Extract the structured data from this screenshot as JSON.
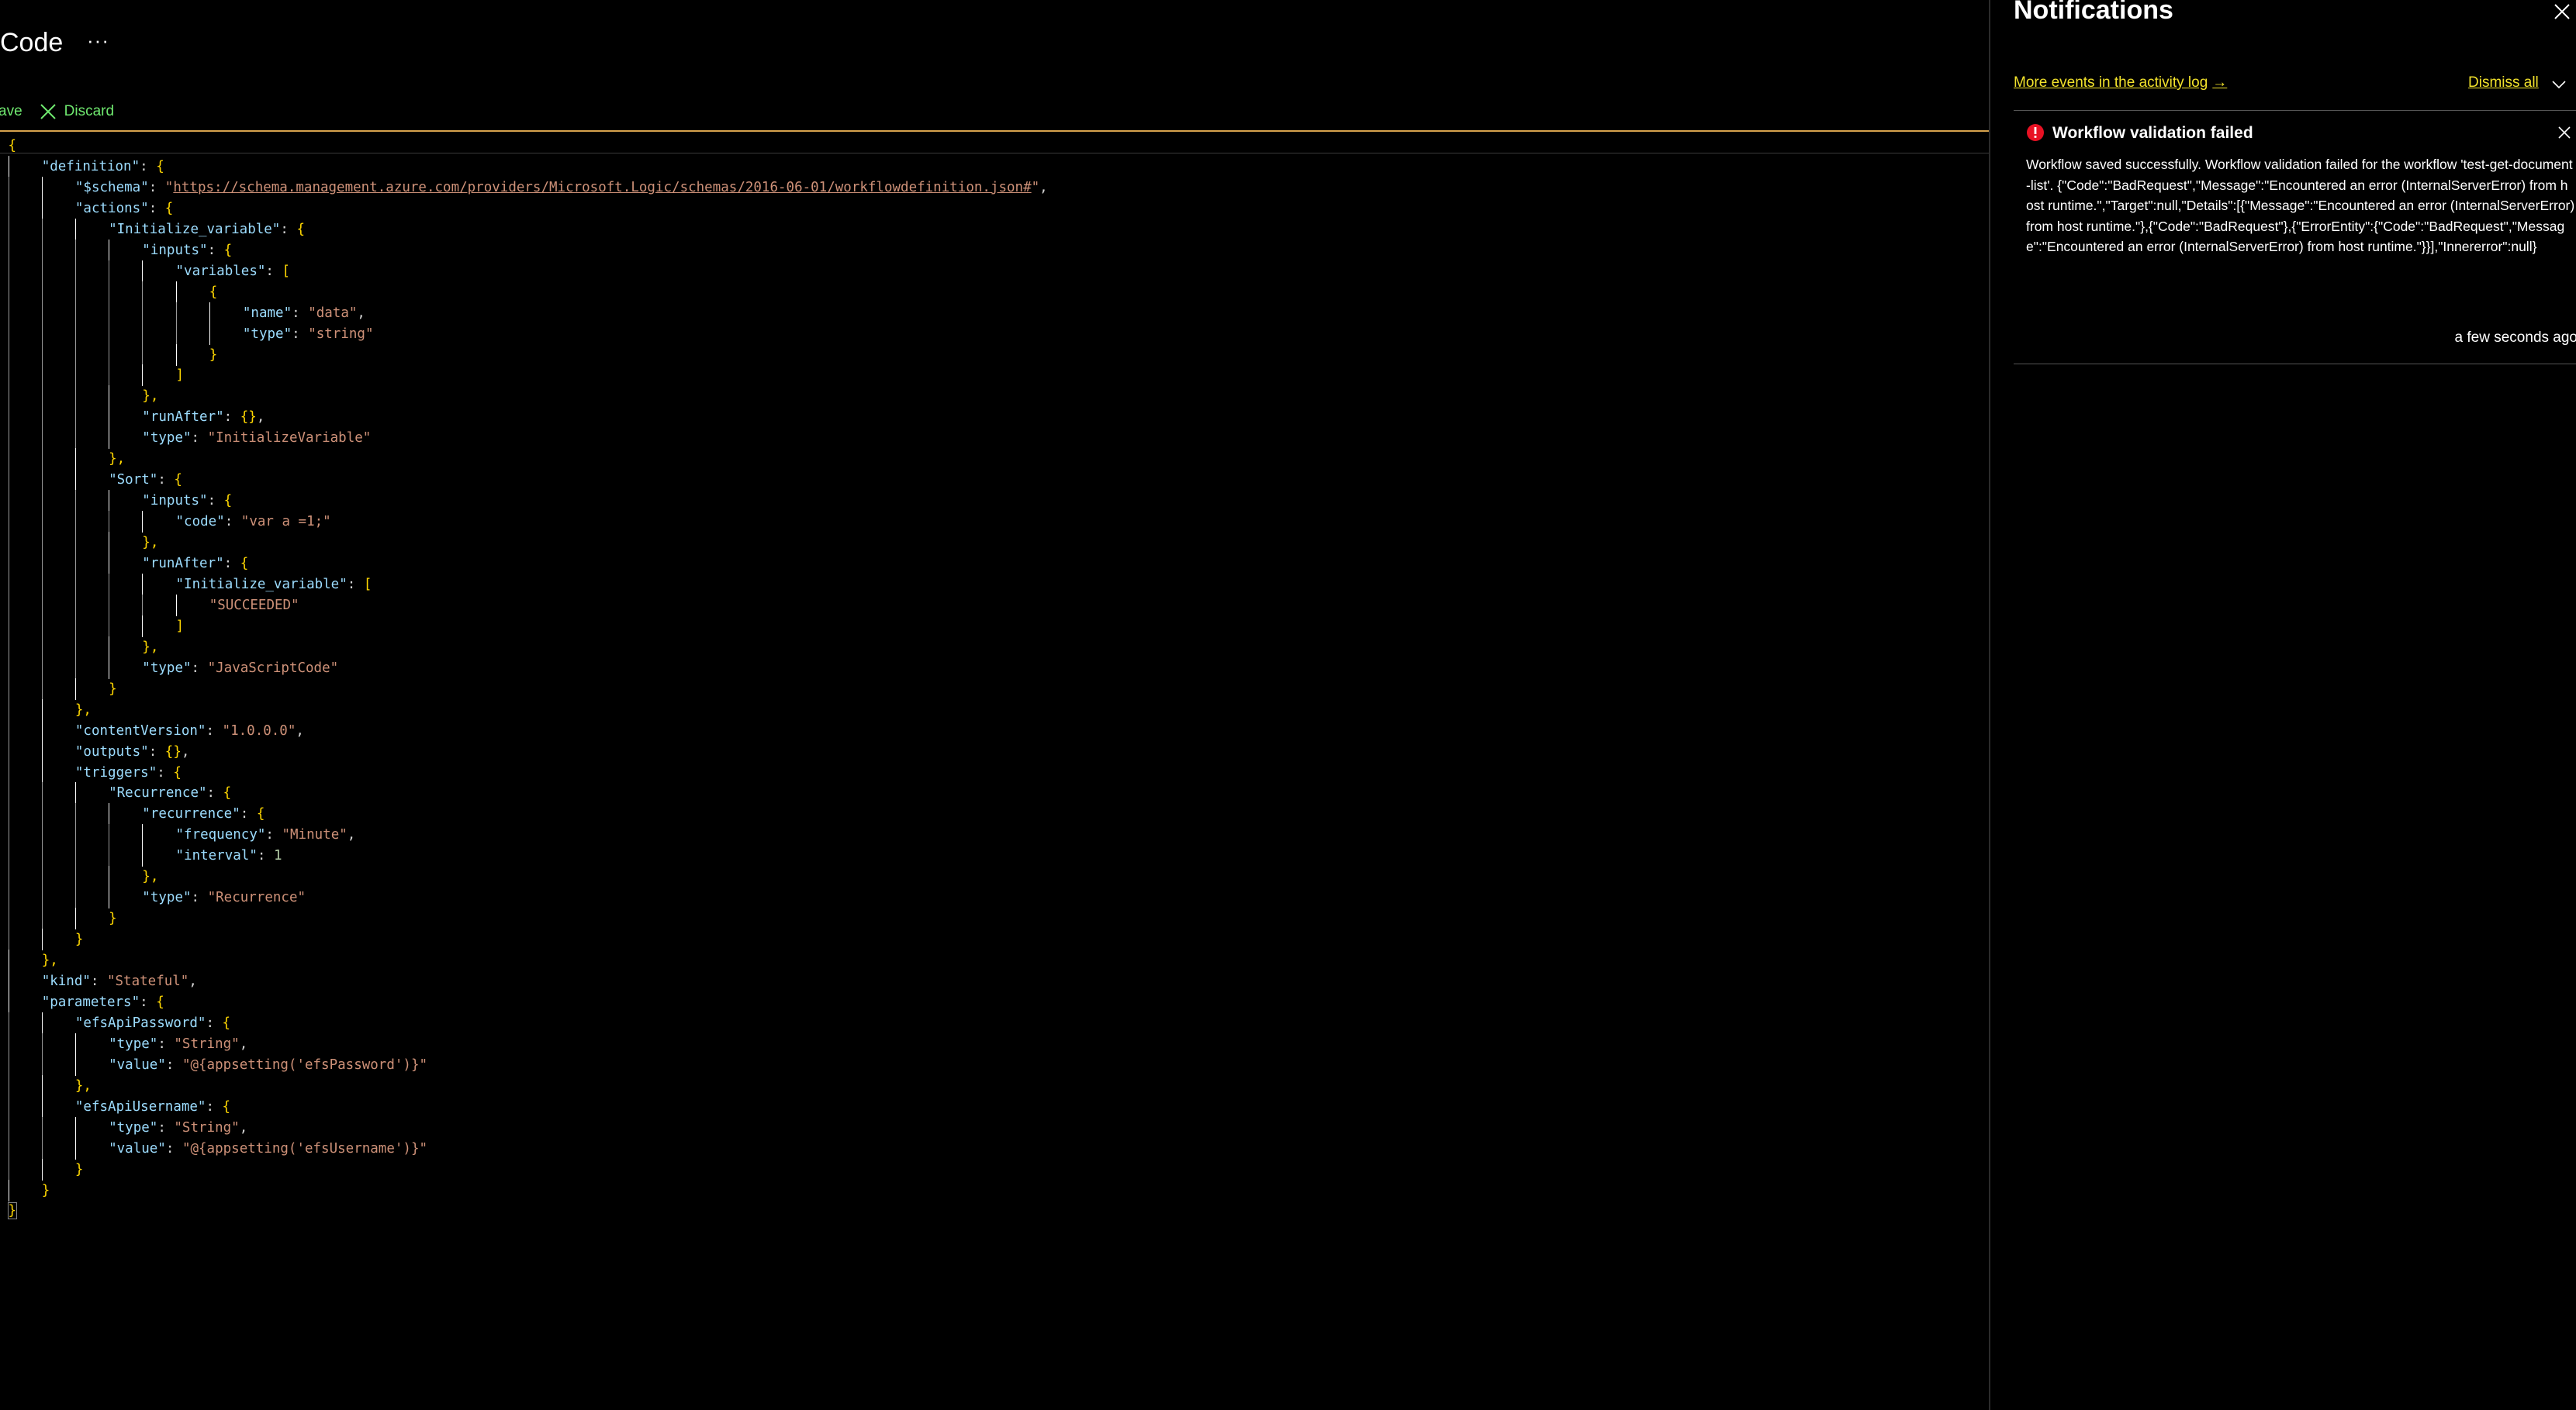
{
  "page": {
    "title": "Code",
    "more_label": "···"
  },
  "toolbar": {
    "save_label": "ave",
    "discard_label": "Discard"
  },
  "editor": {
    "lines": [
      [
        [
          "{",
          "b"
        ]
      ],
      [
        [
          "\"definition\"",
          "k"
        ],
        [
          ": ",
          "p"
        ],
        [
          "{",
          "b"
        ]
      ],
      [
        [
          "\"$schema\"",
          "k"
        ],
        [
          ": ",
          "p"
        ],
        [
          "\"",
          "s"
        ],
        [
          "https://schema.management.azure.com/providers/Microsoft.Logic/schemas/2016-06-01/workflowdefinition.json#",
          "s u"
        ],
        [
          "\"",
          "s"
        ],
        [
          ",",
          "p"
        ]
      ],
      [
        [
          "\"actions\"",
          "k"
        ],
        [
          ": ",
          "p"
        ],
        [
          "{",
          "b"
        ]
      ],
      [
        [
          "\"Initialize_variable\"",
          "k"
        ],
        [
          ": ",
          "p"
        ],
        [
          "{",
          "b"
        ]
      ],
      [
        [
          "\"inputs\"",
          "k"
        ],
        [
          ": ",
          "p"
        ],
        [
          "{",
          "b"
        ]
      ],
      [
        [
          "\"variables\"",
          "k"
        ],
        [
          ": ",
          "p"
        ],
        [
          "[",
          "b"
        ]
      ],
      [
        [
          "{",
          "b"
        ]
      ],
      [
        [
          "\"name\"",
          "k"
        ],
        [
          ": ",
          "p"
        ],
        [
          "\"data\"",
          "s"
        ],
        [
          ",",
          "p"
        ]
      ],
      [
        [
          "\"type\"",
          "k"
        ],
        [
          ": ",
          "p"
        ],
        [
          "\"string\"",
          "s"
        ]
      ],
      [
        [
          "}",
          "b"
        ]
      ],
      [
        [
          "]",
          "b"
        ]
      ],
      [
        [
          "},",
          "b"
        ]
      ],
      [
        [
          "\"runAfter\"",
          "k"
        ],
        [
          ": ",
          "p"
        ],
        [
          "{}",
          "b"
        ],
        [
          ",",
          "p"
        ]
      ],
      [
        [
          "\"type\"",
          "k"
        ],
        [
          ": ",
          "p"
        ],
        [
          "\"InitializeVariable\"",
          "s"
        ]
      ],
      [
        [
          "},",
          "b"
        ]
      ],
      [
        [
          "\"Sort\"",
          "k"
        ],
        [
          ": ",
          "p"
        ],
        [
          "{",
          "b"
        ]
      ],
      [
        [
          "\"inputs\"",
          "k"
        ],
        [
          ": ",
          "p"
        ],
        [
          "{",
          "b"
        ]
      ],
      [
        [
          "\"code\"",
          "k"
        ],
        [
          ": ",
          "p"
        ],
        [
          "\"var a =1;\"",
          "s"
        ]
      ],
      [
        [
          "},",
          "b"
        ]
      ],
      [
        [
          "\"runAfter\"",
          "k"
        ],
        [
          ": ",
          "p"
        ],
        [
          "{",
          "b"
        ]
      ],
      [
        [
          "\"Initialize_variable\"",
          "k"
        ],
        [
          ": ",
          "p"
        ],
        [
          "[",
          "b"
        ]
      ],
      [
        [
          "\"SUCCEEDED\"",
          "s"
        ]
      ],
      [
        [
          "]",
          "b"
        ]
      ],
      [
        [
          "},",
          "b"
        ]
      ],
      [
        [
          "\"type\"",
          "k"
        ],
        [
          ": ",
          "p"
        ],
        [
          "\"JavaScriptCode\"",
          "s"
        ]
      ],
      [
        [
          "}",
          "b"
        ]
      ],
      [
        [
          "},",
          "b"
        ]
      ],
      [
        [
          "\"contentVersion\"",
          "k"
        ],
        [
          ": ",
          "p"
        ],
        [
          "\"1.0.0.0\"",
          "s"
        ],
        [
          ",",
          "p"
        ]
      ],
      [
        [
          "\"outputs\"",
          "k"
        ],
        [
          ": ",
          "p"
        ],
        [
          "{}",
          "b"
        ],
        [
          ",",
          "p"
        ]
      ],
      [
        [
          "\"triggers\"",
          "k"
        ],
        [
          ": ",
          "p"
        ],
        [
          "{",
          "b"
        ]
      ],
      [
        [
          "\"Recurrence\"",
          "k"
        ],
        [
          ": ",
          "p"
        ],
        [
          "{",
          "b"
        ]
      ],
      [
        [
          "\"recurrence\"",
          "k"
        ],
        [
          ": ",
          "p"
        ],
        [
          "{",
          "b"
        ]
      ],
      [
        [
          "\"frequency\"",
          "k"
        ],
        [
          ": ",
          "p"
        ],
        [
          "\"Minute\"",
          "s"
        ],
        [
          ",",
          "p"
        ]
      ],
      [
        [
          "\"interval\"",
          "k"
        ],
        [
          ": ",
          "p"
        ],
        [
          "1",
          "n"
        ]
      ],
      [
        [
          "},",
          "b"
        ]
      ],
      [
        [
          "\"type\"",
          "k"
        ],
        [
          ": ",
          "p"
        ],
        [
          "\"Recurrence\"",
          "s"
        ]
      ],
      [
        [
          "}",
          "b"
        ]
      ],
      [
        [
          "}",
          "b"
        ]
      ],
      [
        [
          "},",
          "b"
        ]
      ],
      [
        [
          "\"kind\"",
          "k"
        ],
        [
          ": ",
          "p"
        ],
        [
          "\"Stateful\"",
          "s"
        ],
        [
          ",",
          "p"
        ]
      ],
      [
        [
          "\"parameters\"",
          "k"
        ],
        [
          ": ",
          "p"
        ],
        [
          "{",
          "b"
        ]
      ],
      [
        [
          "\"efsApiPassword\"",
          "k"
        ],
        [
          ": ",
          "p"
        ],
        [
          "{",
          "b"
        ]
      ],
      [
        [
          "\"type\"",
          "k"
        ],
        [
          ": ",
          "p"
        ],
        [
          "\"String\"",
          "s"
        ],
        [
          ",",
          "p"
        ]
      ],
      [
        [
          "\"value\"",
          "k"
        ],
        [
          ": ",
          "p"
        ],
        [
          "\"@{appsetting('efsPassword')}\"",
          "s"
        ]
      ],
      [
        [
          "},",
          "b"
        ]
      ],
      [
        [
          "\"efsApiUsername\"",
          "k"
        ],
        [
          ": ",
          "p"
        ],
        [
          "{",
          "b"
        ]
      ],
      [
        [
          "\"type\"",
          "k"
        ],
        [
          ": ",
          "p"
        ],
        [
          "\"String\"",
          "s"
        ],
        [
          ",",
          "p"
        ]
      ],
      [
        [
          "\"value\"",
          "k"
        ],
        [
          ": ",
          "p"
        ],
        [
          "\"@{appsetting('efsUsername')}\"",
          "s"
        ]
      ],
      [
        [
          "}",
          "b"
        ]
      ],
      [
        [
          "}",
          "b"
        ]
      ],
      [
        [
          "}",
          "b bm"
        ]
      ]
    ]
  },
  "notifications": {
    "title": "Notifications",
    "activity_link": "More events in the activity log",
    "activity_arrow": "→",
    "dismiss_all": "Dismiss all",
    "items": [
      {
        "title": "Workflow validation failed",
        "message": "Workflow saved successfully. Workflow validation failed for the workflow 'test-get-document-list'. {\"Code\":\"BadRequest\",\"Message\":\"Encountered an error (InternalServerError) from host runtime.\",\"Target\":null,\"Details\":[{\"Message\":\"Encountered an error (InternalServerError) from host runtime.\"},{\"Code\":\"BadRequest\"},{\"ErrorEntity\":{\"Code\":\"BadRequest\",\"Message\":\"Encountered an error (InternalServerError) from host runtime.\"}}],\"Innererror\":null}",
        "time": "a few seconds ago",
        "severity_color": "#e81123"
      }
    ]
  },
  "colors": {
    "accent_green": "#6fe86f",
    "link_yellow": "#f2e22b",
    "editor_top_border": "#d6a24d"
  }
}
